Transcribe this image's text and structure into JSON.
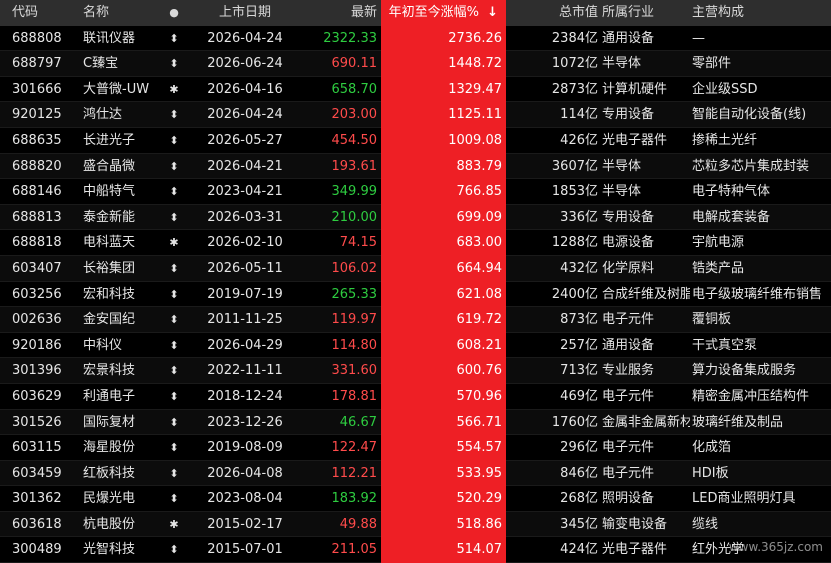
{
  "header": {
    "code": "代码",
    "name": "名称",
    "mark": "●",
    "date": "上市日期",
    "last": "最新",
    "pct": "年初至今涨幅%",
    "sort_arrow": "↓",
    "cap": "总市值",
    "industry": "所属行业",
    "main": "主营构成"
  },
  "colors": {
    "up": "#ff4b4b",
    "down": "#2ecc40",
    "highlight": "#ee1f25"
  },
  "rows": [
    {
      "code": "688808",
      "name": "联讯仪器",
      "mark": "⬍",
      "date": "2026-04-24",
      "last": "2322.33",
      "dir": "dn",
      "pct": "2736.26",
      "cap": "2384亿",
      "industry": "通用设备",
      "main": "—"
    },
    {
      "code": "688797",
      "name": "C臻宝",
      "mark": "⬍",
      "date": "2026-06-24",
      "last": "690.11",
      "dir": "up",
      "pct": "1448.72",
      "cap": "1072亿",
      "industry": "半导体",
      "main": "零部件"
    },
    {
      "code": "301666",
      "name": "大普微-UW",
      "mark": "✱",
      "date": "2026-04-16",
      "last": "658.70",
      "dir": "dn",
      "pct": "1329.47",
      "cap": "2873亿",
      "industry": "计算机硬件",
      "main": "企业级SSD"
    },
    {
      "code": "920125",
      "name": "鸿仕达",
      "mark": "⬍",
      "date": "2026-04-24",
      "last": "203.00",
      "dir": "up",
      "pct": "1125.11",
      "cap": "114亿",
      "industry": "专用设备",
      "main": "智能自动化设备(线)"
    },
    {
      "code": "688635",
      "name": "长进光子",
      "mark": "⬍",
      "date": "2026-05-27",
      "last": "454.50",
      "dir": "up",
      "pct": "1009.08",
      "cap": "426亿",
      "industry": "光电子器件",
      "main": "掺稀土光纤"
    },
    {
      "code": "688820",
      "name": "盛合晶微",
      "mark": "⬍",
      "date": "2026-04-21",
      "last": "193.61",
      "dir": "up",
      "pct": "883.79",
      "cap": "3607亿",
      "industry": "半导体",
      "main": "芯粒多芯片集成封装"
    },
    {
      "code": "688146",
      "name": "中船特气",
      "mark": "⬍",
      "date": "2023-04-21",
      "last": "349.99",
      "dir": "dn",
      "pct": "766.85",
      "cap": "1853亿",
      "industry": "半导体",
      "main": "电子特种气体"
    },
    {
      "code": "688813",
      "name": "泰金新能",
      "mark": "⬍",
      "date": "2026-03-31",
      "last": "210.00",
      "dir": "dn",
      "pct": "699.09",
      "cap": "336亿",
      "industry": "专用设备",
      "main": "电解成套装备"
    },
    {
      "code": "688818",
      "name": "电科蓝天",
      "mark": "✱",
      "date": "2026-02-10",
      "last": "74.15",
      "dir": "up",
      "pct": "683.00",
      "cap": "1288亿",
      "industry": "电源设备",
      "main": "宇航电源"
    },
    {
      "code": "603407",
      "name": "长裕集团",
      "mark": "⬍",
      "date": "2026-05-11",
      "last": "106.02",
      "dir": "up",
      "pct": "664.94",
      "cap": "432亿",
      "industry": "化学原料",
      "main": "锆类产品"
    },
    {
      "code": "603256",
      "name": "宏和科技",
      "mark": "⬍",
      "date": "2019-07-19",
      "last": "265.33",
      "dir": "dn",
      "pct": "621.08",
      "cap": "2400亿",
      "industry": "合成纤维及树脂",
      "main": "电子级玻璃纤维布销售"
    },
    {
      "code": "002636",
      "name": "金安国纪",
      "mark": "⬍",
      "date": "2011-11-25",
      "last": "119.97",
      "dir": "up",
      "pct": "619.72",
      "cap": "873亿",
      "industry": "电子元件",
      "main": "覆铜板"
    },
    {
      "code": "920186",
      "name": "中科仪",
      "mark": "⬍",
      "date": "2026-04-29",
      "last": "114.80",
      "dir": "up",
      "pct": "608.21",
      "cap": "257亿",
      "industry": "通用设备",
      "main": "干式真空泵"
    },
    {
      "code": "301396",
      "name": "宏景科技",
      "mark": "⬍",
      "date": "2022-11-11",
      "last": "331.60",
      "dir": "up",
      "pct": "600.76",
      "cap": "713亿",
      "industry": "专业服务",
      "main": "算力设备集成服务"
    },
    {
      "code": "603629",
      "name": "利通电子",
      "mark": "⬍",
      "date": "2018-12-24",
      "last": "178.81",
      "dir": "up",
      "pct": "570.96",
      "cap": "469亿",
      "industry": "电子元件",
      "main": "精密金属冲压结构件"
    },
    {
      "code": "301526",
      "name": "国际复材",
      "mark": "⬍",
      "date": "2023-12-26",
      "last": "46.67",
      "dir": "dn",
      "pct": "566.71",
      "cap": "1760亿",
      "industry": "金属非金属新材",
      "main": "玻璃纤维及制品"
    },
    {
      "code": "603115",
      "name": "海星股份",
      "mark": "⬍",
      "date": "2019-08-09",
      "last": "122.47",
      "dir": "up",
      "pct": "554.57",
      "cap": "296亿",
      "industry": "电子元件",
      "main": "化成箔"
    },
    {
      "code": "603459",
      "name": "红板科技",
      "mark": "⬍",
      "date": "2026-04-08",
      "last": "112.21",
      "dir": "up",
      "pct": "533.95",
      "cap": "846亿",
      "industry": "电子元件",
      "main": "HDI板"
    },
    {
      "code": "301362",
      "name": "民爆光电",
      "mark": "⬍",
      "date": "2023-08-04",
      "last": "183.92",
      "dir": "dn",
      "pct": "520.29",
      "cap": "268亿",
      "industry": "照明设备",
      "main": "LED商业照明灯具"
    },
    {
      "code": "603618",
      "name": "杭电股份",
      "mark": "✱",
      "date": "2015-02-17",
      "last": "49.88",
      "dir": "up",
      "pct": "518.86",
      "cap": "345亿",
      "industry": "输变电设备",
      "main": "缆线"
    },
    {
      "code": "300489",
      "name": "光智科技",
      "mark": "⬍",
      "date": "2015-07-01",
      "last": "211.05",
      "dir": "up",
      "pct": "514.07",
      "cap": "424亿",
      "industry": "光电子器件",
      "main": "红外光学"
    }
  ],
  "watermark": "www.365jz.com"
}
